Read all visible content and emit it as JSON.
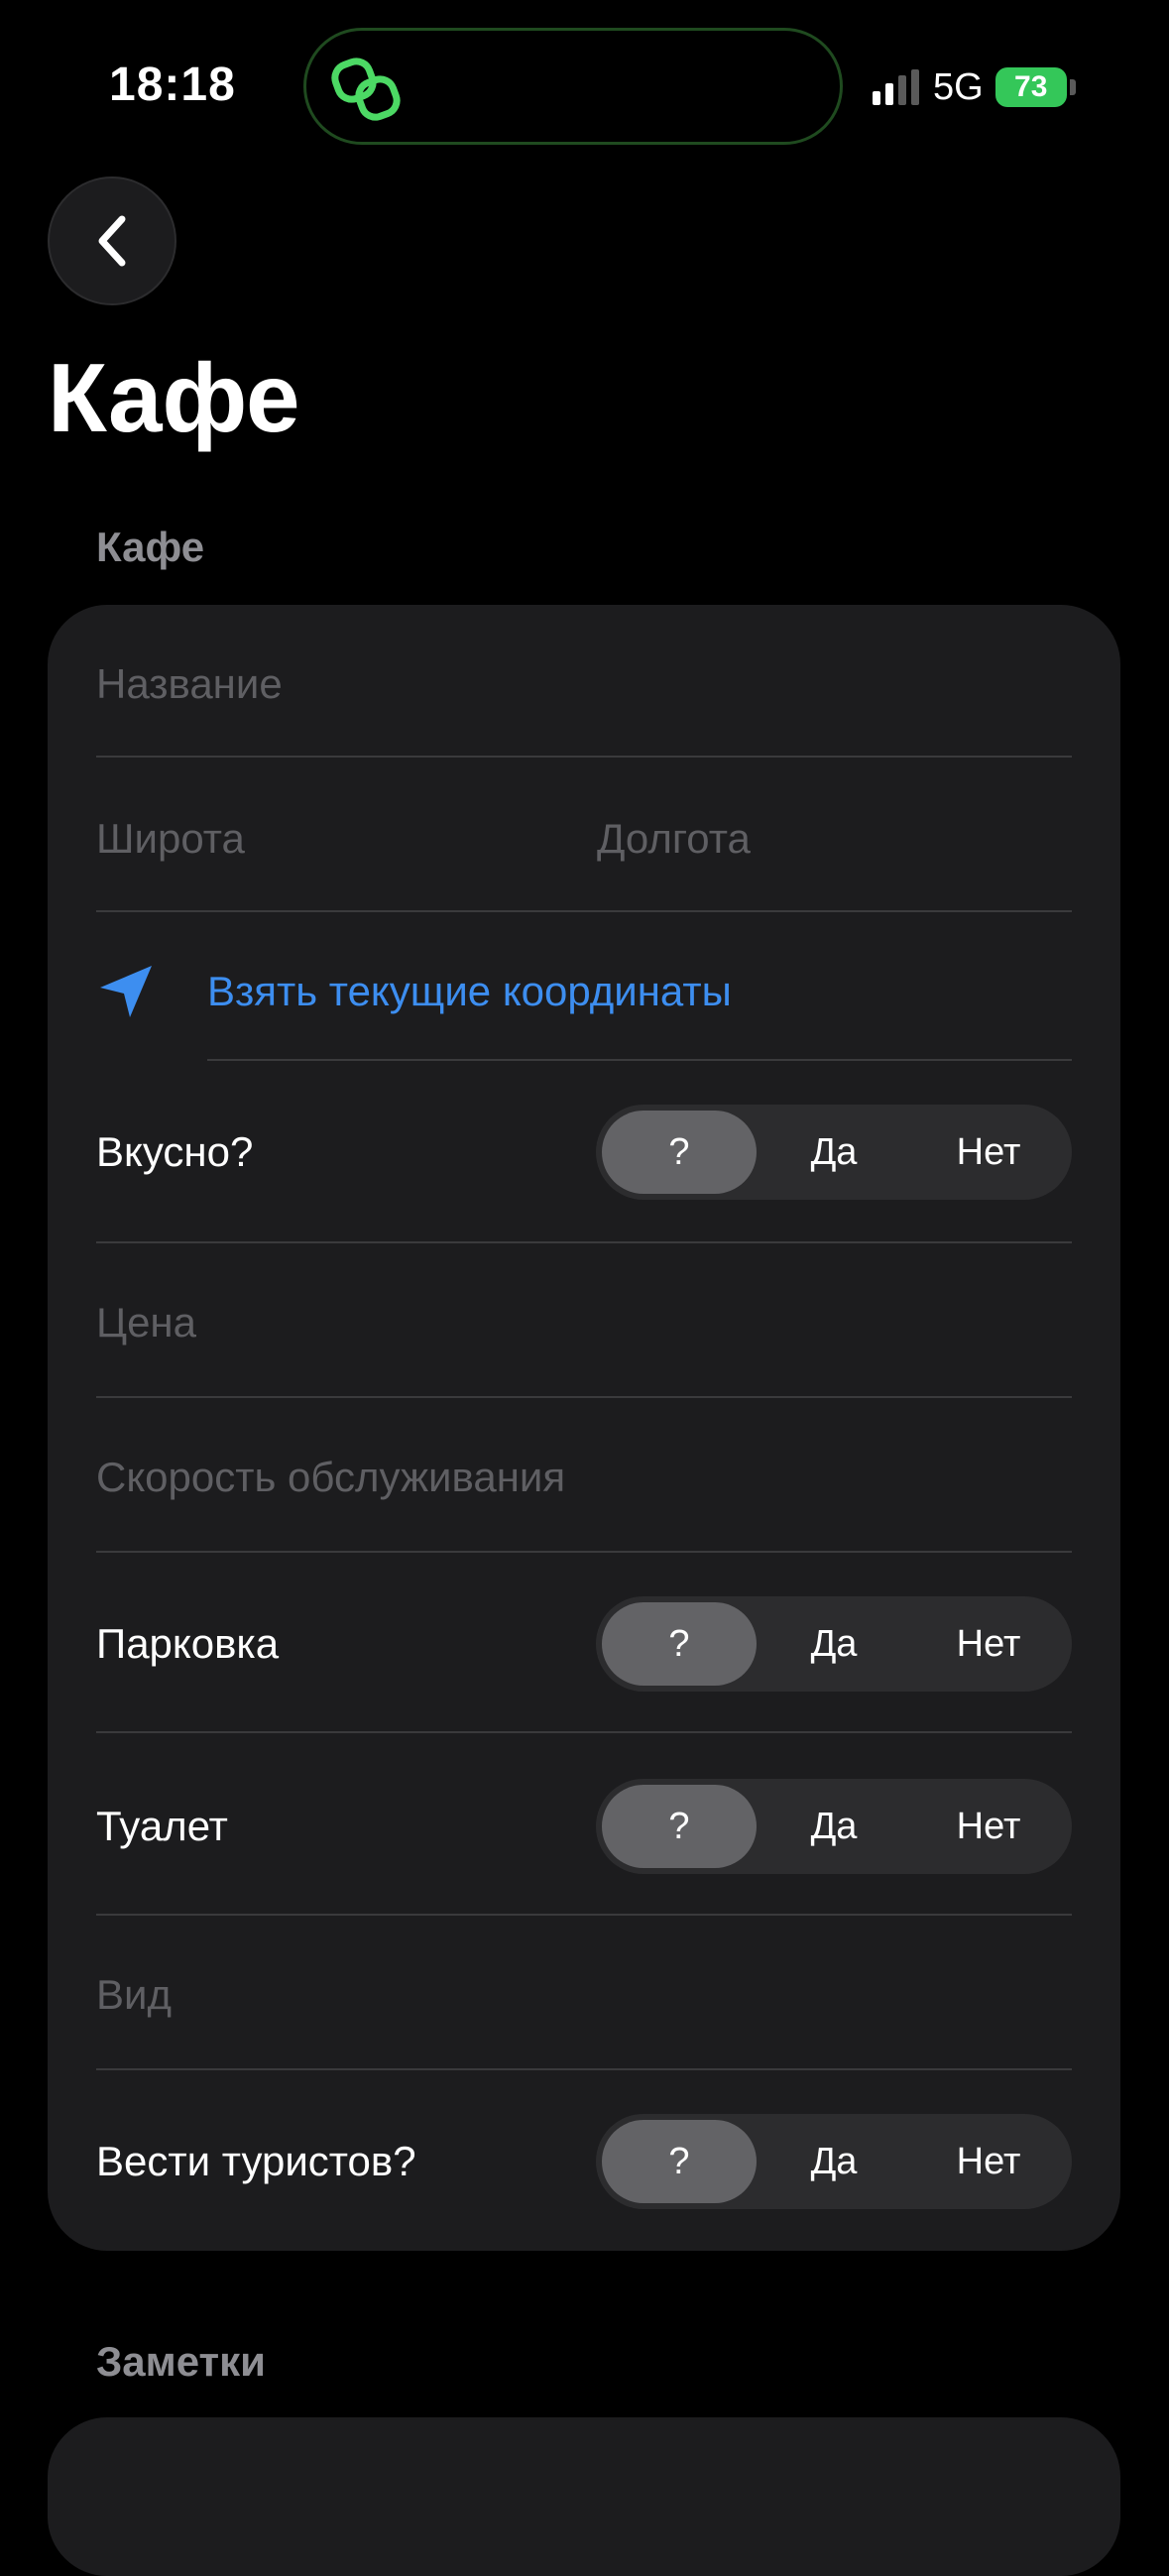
{
  "status_bar": {
    "time": "18:18",
    "network": "5G",
    "battery": "73"
  },
  "nav": {
    "title": "Кафе"
  },
  "sections": {
    "main_header": "Кафе",
    "notes_header": "Заметки"
  },
  "form": {
    "name_placeholder": "Название",
    "latitude_placeholder": "Широта",
    "longitude_placeholder": "Долгота",
    "location_link": "Взять текущие координаты",
    "tasty_label": "Вкусно?",
    "price_placeholder": "Цена",
    "speed_placeholder": "Скорость обслуживания",
    "parking_label": "Парковка",
    "toilet_label": "Туалет",
    "view_placeholder": "Вид",
    "tourists_label": "Вести туристов?"
  },
  "segment_options": [
    "?",
    "Да",
    "Нет"
  ],
  "segment_selected": {
    "tasty": "?",
    "parking": "?",
    "toilet": "?",
    "tourists": "?"
  },
  "colors": {
    "accent": "#3d8ef0",
    "battery": "#34c759",
    "card": "#1c1c1e",
    "background": "#000000"
  }
}
